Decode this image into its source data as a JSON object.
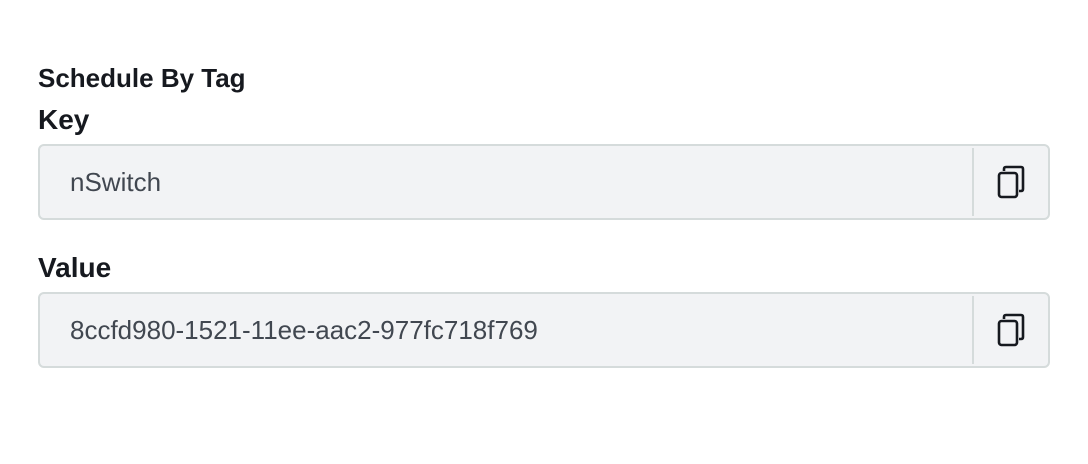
{
  "section": {
    "title": "Schedule By Tag"
  },
  "fields": [
    {
      "label": "Key",
      "value": "nSwitch",
      "copy_icon": "copy-icon"
    },
    {
      "label": "Value",
      "value": "8ccfd980-1521-11ee-aac2-977fc718f769",
      "copy_icon": "copy-icon"
    }
  ],
  "colors": {
    "field_background": "#f2f3f5",
    "field_border": "#d5dbdb",
    "label_text": "#16191f",
    "value_text": "#414750"
  }
}
